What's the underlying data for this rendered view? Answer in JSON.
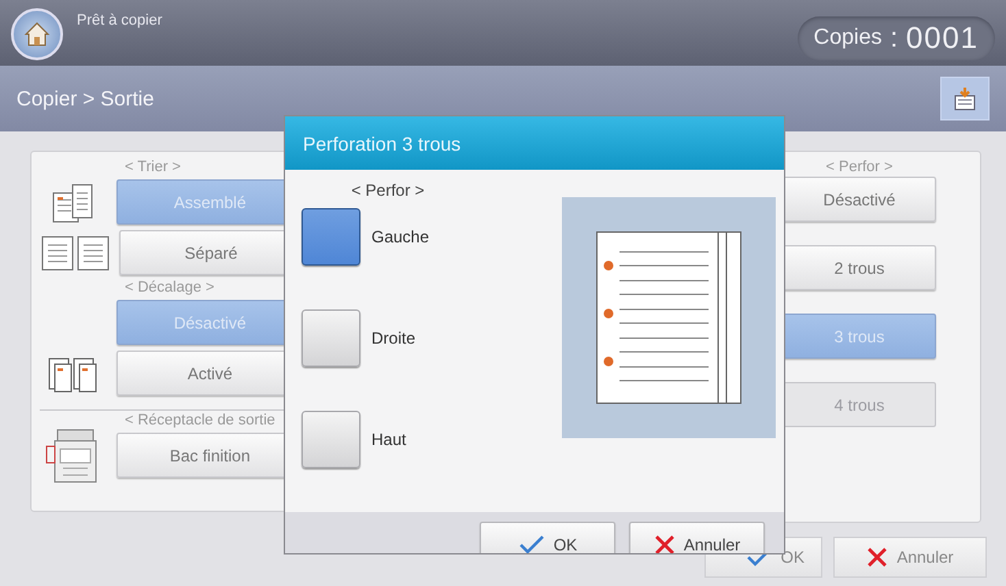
{
  "header": {
    "status": "Prêt à copier",
    "copies_label": "Copies",
    "copies_separator": ":",
    "copies_value": "0001"
  },
  "breadcrumb": "Copier > Sortie",
  "left_groups": [
    {
      "title": "< Trier >",
      "options": [
        {
          "label": "Assemblé",
          "selected": true
        },
        {
          "label": "Séparé",
          "selected": false
        }
      ]
    },
    {
      "title": "< Décalage >",
      "options": [
        {
          "label": "Désactivé",
          "selected": true
        },
        {
          "label": "Activé",
          "selected": false
        }
      ]
    },
    {
      "title": "< Réceptacle de sortie",
      "options": [
        {
          "label": "Bac finition",
          "selected": false
        }
      ]
    }
  ],
  "right_group": {
    "title": "< Perfor >",
    "options": [
      {
        "label": "Désactivé",
        "selected": false,
        "disabled": false
      },
      {
        "label": "2 trous",
        "selected": false,
        "disabled": false
      },
      {
        "label": "3 trous",
        "selected": true,
        "disabled": false
      },
      {
        "label": "4 trous",
        "selected": false,
        "disabled": true
      }
    ]
  },
  "footer_buttons": [
    {
      "kind": "ok",
      "label": "OK"
    },
    {
      "kind": "cancel",
      "label": "Annuler"
    }
  ],
  "dialog": {
    "title": "Perforation 3 trous",
    "section": "< Perfor >",
    "options": [
      {
        "label": "Gauche",
        "selected": true
      },
      {
        "label": "Droite",
        "selected": false
      },
      {
        "label": "Haut",
        "selected": false
      }
    ],
    "buttons": [
      {
        "kind": "ok",
        "label": "OK"
      },
      {
        "kind": "cancel",
        "label": "Annuler"
      }
    ]
  }
}
